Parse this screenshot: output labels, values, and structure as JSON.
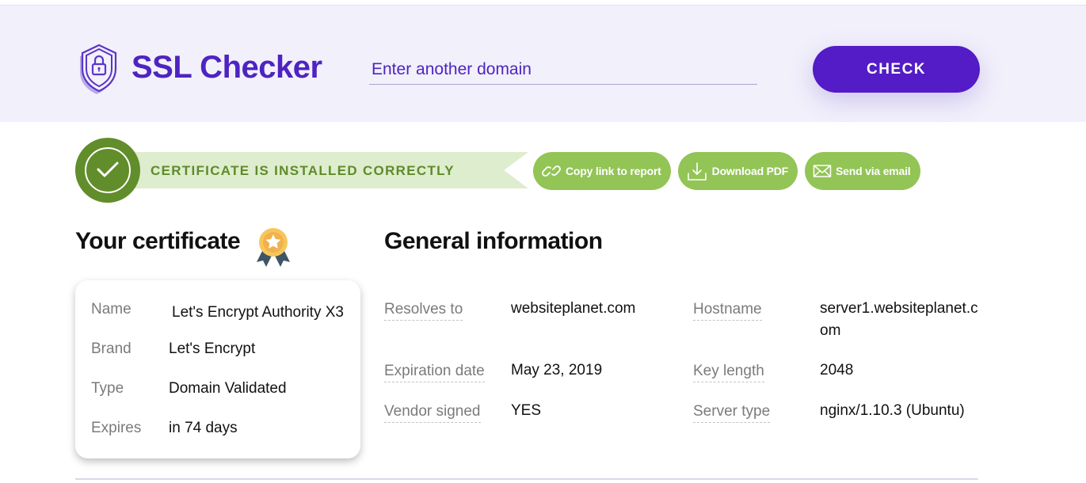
{
  "header": {
    "brand": "SSL Checker",
    "logo_icon": "shield-lock-icon",
    "domain_input": {
      "placeholder": "Enter another domain",
      "value": ""
    },
    "check_label": "CHECK"
  },
  "status": {
    "icon": "check-circle-icon",
    "text": "CERTIFICATE IS INSTALLED CORRECTLY"
  },
  "actions": [
    {
      "label": "Copy link to report",
      "icon": "link-icon"
    },
    {
      "label": "Download PDF",
      "icon": "download-icon"
    },
    {
      "label": "Send via email",
      "icon": "envelope-icon"
    }
  ],
  "certificate": {
    "title": "Your certificate",
    "badge_icon": "medal-icon",
    "rows": [
      {
        "key": "Name",
        "value": "Let's Encrypt Authority X3"
      },
      {
        "key": "Brand",
        "value": "Let's Encrypt"
      },
      {
        "key": "Type",
        "value": "Domain Validated"
      },
      {
        "key": "Expires",
        "value": "in 74 days"
      }
    ]
  },
  "general": {
    "title": "General information",
    "left": [
      {
        "key": "Resolves to",
        "value": "websiteplanet.com"
      },
      {
        "key": "Expiration date",
        "value": "May 23, 2019"
      },
      {
        "key": "Vendor signed",
        "value": "YES"
      }
    ],
    "right": [
      {
        "key": "Hostname",
        "value": "server1.websiteplanet.com"
      },
      {
        "key": "Key length",
        "value": "2048"
      },
      {
        "key": "Server type",
        "value": "nginx/1.10.3 (Ubuntu)"
      }
    ]
  },
  "colors": {
    "brand_purple": "#531cc6",
    "header_bg": "#f2f0fb",
    "success_dark": "#618d2b",
    "success_light": "#deedcd",
    "action_green": "#93c456"
  }
}
